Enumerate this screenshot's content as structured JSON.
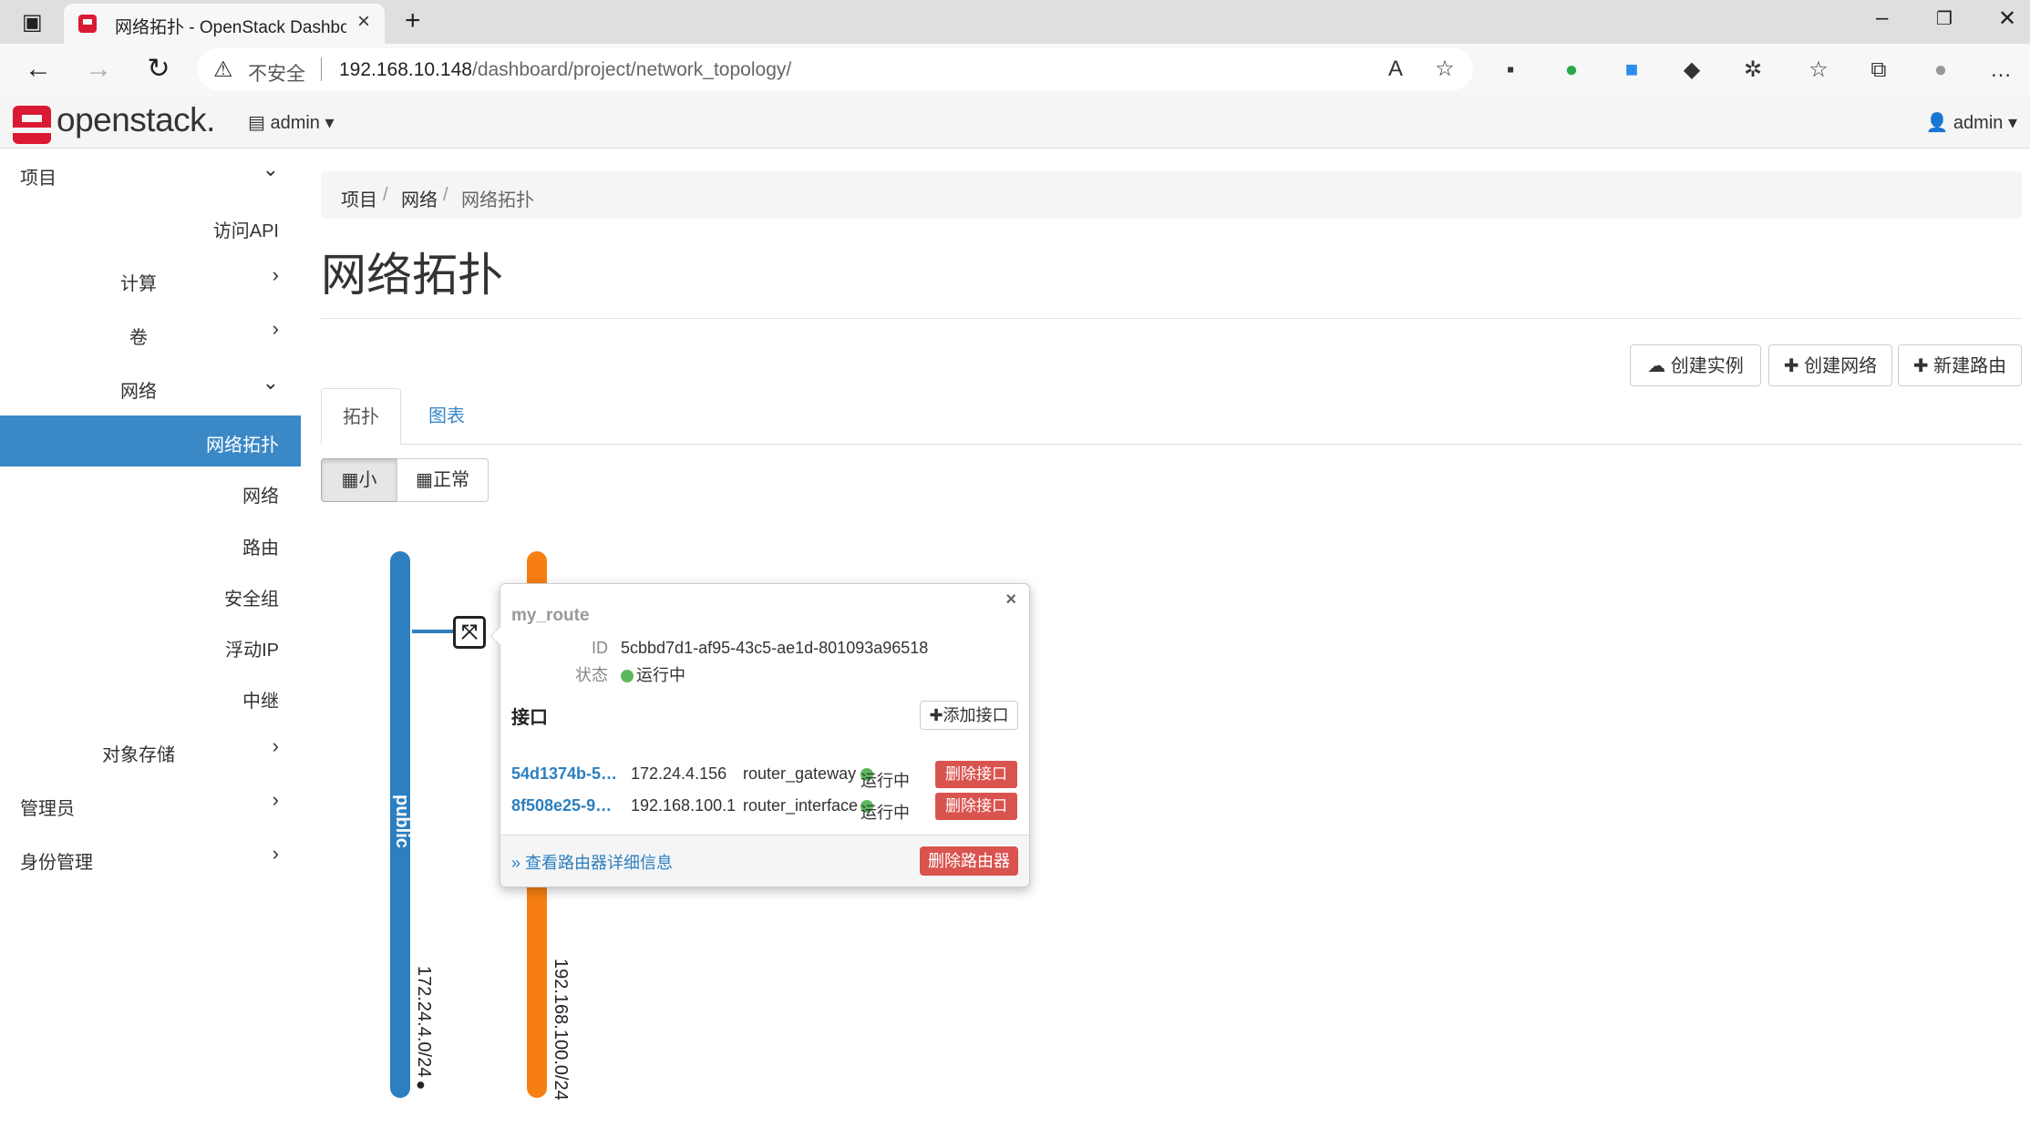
{
  "browser": {
    "tab_title": "网络拓扑 - OpenStack Dashboard",
    "security_label": "不安全",
    "url_host": "192.168.10.148",
    "url_path": "/dashboard/project/network_topology/"
  },
  "header": {
    "logo": "openstack.",
    "project": "admin",
    "user": "admin"
  },
  "sidebar": {
    "items": [
      {
        "label": "项目"
      },
      {
        "label": "访问API"
      },
      {
        "label": "计算"
      },
      {
        "label": "卷"
      },
      {
        "label": "网络"
      },
      {
        "label": "网络拓扑"
      },
      {
        "label": "网络"
      },
      {
        "label": "路由"
      },
      {
        "label": "安全组"
      },
      {
        "label": "浮动IP"
      },
      {
        "label": "中继"
      },
      {
        "label": "对象存储"
      },
      {
        "label": "管理员"
      },
      {
        "label": "身份管理"
      }
    ]
  },
  "breadcrumb": [
    "项目",
    "网络",
    "网络拓扑"
  ],
  "page_title": "网络拓扑",
  "actions": {
    "create_instance": "创建实例",
    "create_network": "创建网络",
    "create_router": "新建路由"
  },
  "tabs": {
    "topology": "拓扑",
    "graph": "图表"
  },
  "size_toggle": {
    "small": "小",
    "normal": "正常"
  },
  "networks": [
    {
      "name": "public",
      "cidr": "172.24.4.0/24",
      "color": "#2c7fc0"
    },
    {
      "name": "",
      "cidr": "192.168.100.0/24",
      "color": "#f77f11"
    }
  ],
  "router_popup": {
    "name": "my_route",
    "id_label": "ID",
    "id_value": "5cbbd7d1-af95-43c5-ae1d-801093a96518",
    "status_label": "状态",
    "status_value": "运行中",
    "interfaces_title": "接口",
    "add_interface": "添加接口",
    "interfaces": [
      {
        "id": "54d1374b-5…",
        "ip": "172.24.4.156",
        "type": "router_gateway",
        "status": "运行中",
        "delete": "删除接口"
      },
      {
        "id": "8f508e25-9…",
        "ip": "192.168.100.1",
        "type": "router_interface",
        "status": "运行中",
        "delete": "删除接口"
      }
    ],
    "detail_link": "» 查看路由器详细信息",
    "delete_router": "删除路由器"
  }
}
